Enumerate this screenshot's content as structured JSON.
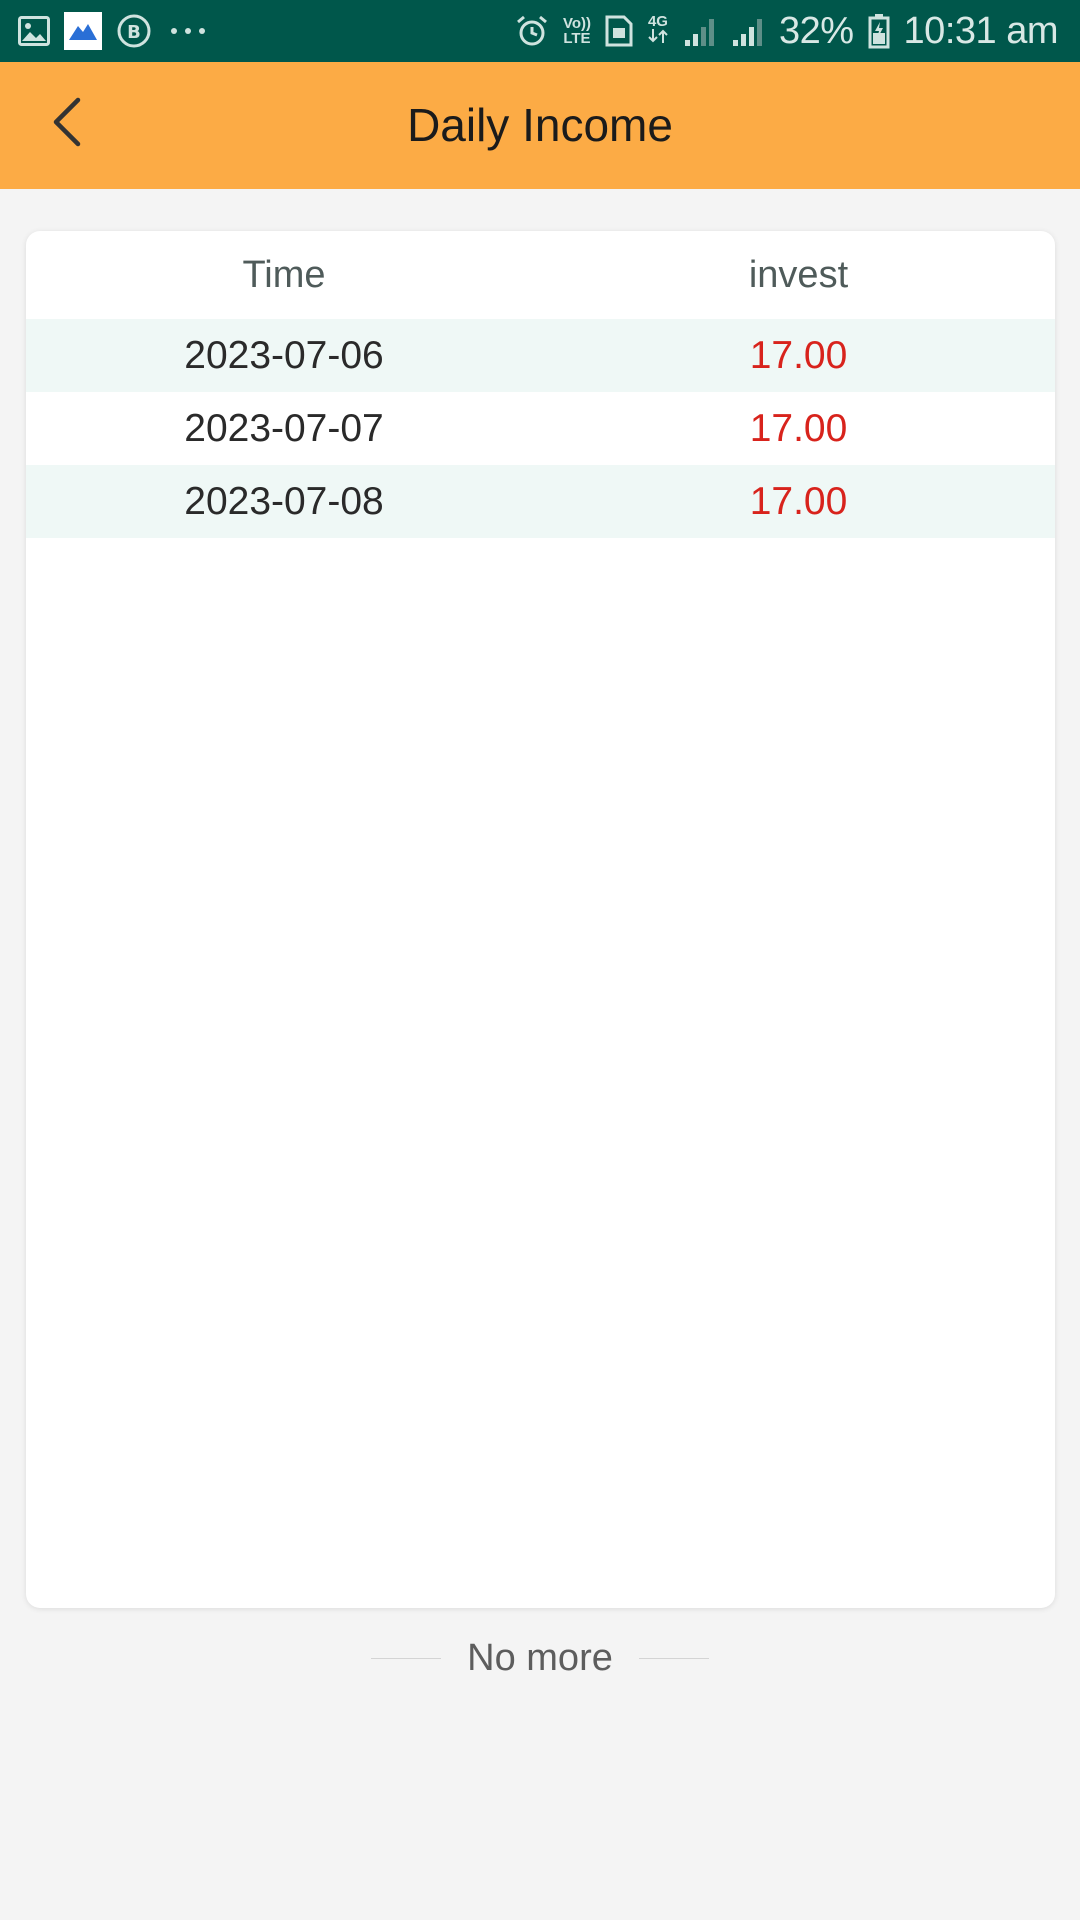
{
  "status_bar": {
    "left_icons": [
      "gallery-icon",
      "mountain-app-icon",
      "b-circle-icon",
      "more-dots-icon"
    ],
    "right_icons": [
      "alarm-icon",
      "volte-icon",
      "sim-icon",
      "4g-icon",
      "signal-icon",
      "signal-icon-2",
      "battery-icon"
    ],
    "volte_top": "Vo))",
    "volte_bottom": "LTE",
    "network_type": "4G",
    "battery_percent": "32%",
    "time": "10:31 am"
  },
  "header": {
    "title": "Daily Income",
    "back_icon": "chevron-left-icon",
    "background_color": "#fcab45"
  },
  "table": {
    "columns": [
      "Time",
      "invest"
    ],
    "rows": [
      {
        "time": "2023-07-06",
        "invest": "17.00"
      },
      {
        "time": "2023-07-07",
        "invest": "17.00"
      },
      {
        "time": "2023-07-08",
        "invest": "17.00"
      }
    ],
    "value_color": "#d8231c",
    "stripe_color": "#eff8f6"
  },
  "footer": {
    "no_more_text": "No more"
  }
}
